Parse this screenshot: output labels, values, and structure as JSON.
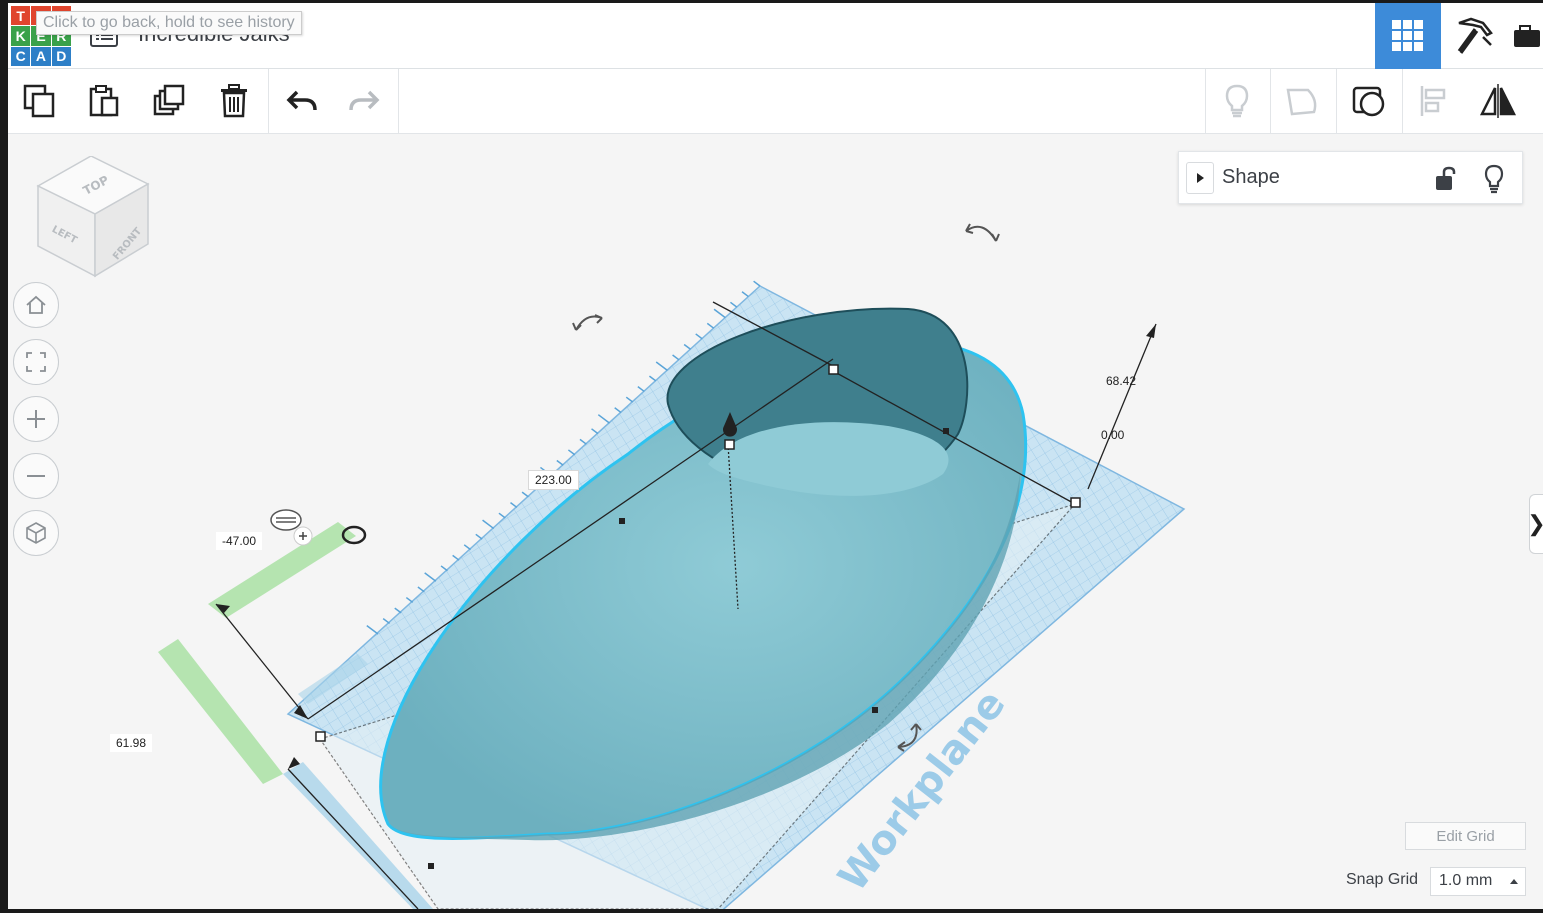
{
  "header": {
    "logo_letters": [
      "T",
      "I",
      "N",
      "K",
      "E",
      "R",
      "C",
      "A",
      "D"
    ],
    "logo_colors": [
      "#e0452e",
      "#e0452e",
      "#e0452e",
      "#3aa14a",
      "#3aa14a",
      "#3aa14a",
      "#2d7fc7",
      "#2d7fc7",
      "#2d7fc7"
    ],
    "tooltip": "Click to go back, hold to see history",
    "design_title": "Incredible Jaiks",
    "grid_view_icon": "grid-icon",
    "pickaxe_icon": "pickaxe-icon",
    "briefcase_icon": "briefcase-icon",
    "accent_color": "#3d8bd9"
  },
  "toolbar": {
    "left_icons": [
      "copy-icon",
      "paste-icon",
      "duplicate-icon",
      "delete-icon",
      "undo-icon",
      "redo-icon"
    ],
    "right_icons": [
      "bulb-icon",
      "shape-outline-icon",
      "shape-group-icon",
      "align-icon",
      "mirror-icon"
    ]
  },
  "viewcube": {
    "top": "TOP",
    "left": "LEFT",
    "front": "FRONT"
  },
  "nav_buttons": [
    "home-icon",
    "fit-view-icon",
    "zoom-in-icon",
    "zoom-out-icon",
    "perspective-icon"
  ],
  "shape_panel": {
    "title": "Shape"
  },
  "dimensions": {
    "length": "223.00",
    "height": "68.42",
    "elevation": "0.00",
    "offset": "-47.00",
    "width": "61.98"
  },
  "workplane_label": "Workplane",
  "edit_grid_label": "Edit Grid",
  "snap_grid": {
    "label": "Snap Grid",
    "value": "1.0 mm"
  }
}
